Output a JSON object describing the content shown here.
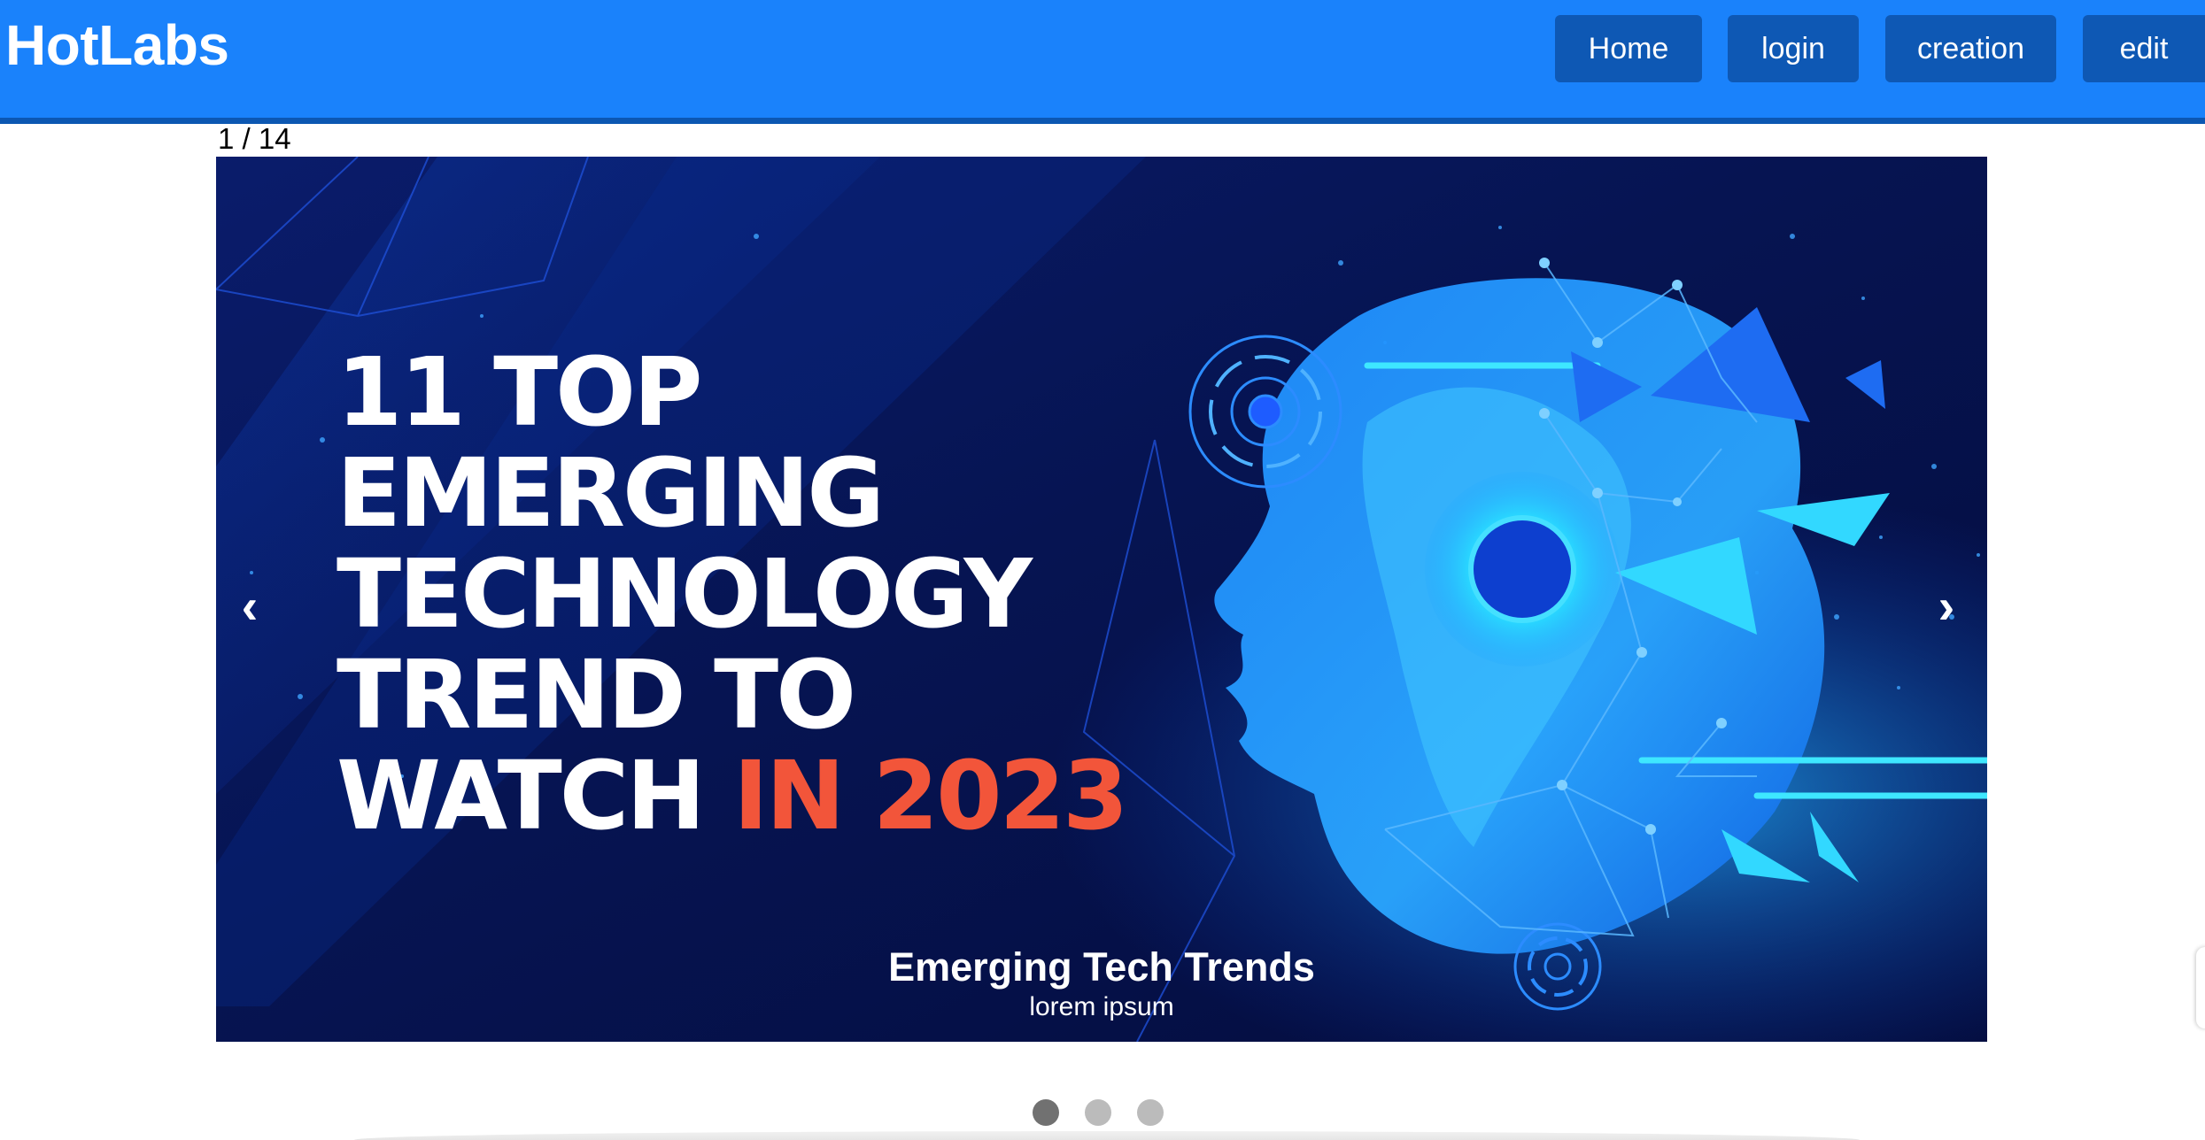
{
  "brand": {
    "name": "HotLabs"
  },
  "nav": {
    "home": "Home",
    "login": "login",
    "creation": "creation",
    "edit": "edit"
  },
  "slideshow": {
    "counter": "1 / 14",
    "headline": {
      "line1": "11 TOP",
      "line2": "EMERGING",
      "line3": "TECHNOLOGY",
      "line4": "TREND TO",
      "line5_prefix": "WATCH ",
      "line5_accent": "IN 2023"
    },
    "caption_title": "Emerging Tech Trends",
    "caption_subtitle": "lorem ipsum",
    "prev_glyph": "‹",
    "next_glyph": "›",
    "current_slide": 1,
    "total_slides": 14,
    "dot_count": 3,
    "active_dot": 1
  },
  "colors": {
    "navbar": "#1a82fb",
    "nav_button": "#0e58b4",
    "accent_text": "#f2553a",
    "slide_background": "#06155a",
    "ai_head": "#2aa6ff"
  },
  "icons": {
    "prev": "chevron-left-icon",
    "next": "chevron-right-icon"
  }
}
